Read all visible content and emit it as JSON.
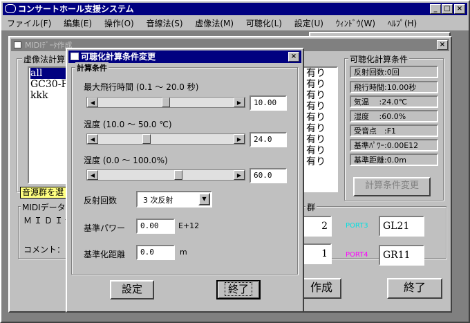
{
  "app": {
    "title": "コンサートホール支援システム",
    "menu": [
      "ファイル(F)",
      "編集(E)",
      "操作(O)",
      "音線法(S)",
      "虚像法(M)",
      "可聴化(L)",
      "設定(U)",
      "ｳｨﾝﾄﾞｳ(W)",
      "ﾍﾙﾌﾟ(H)"
    ]
  },
  "midi_window": {
    "title": "MIDIﾃﾞｰﾀ作成",
    "mirror_group_label": "虚像法計算",
    "mirror_items": [
      "all",
      "GC30-F1",
      "kkk"
    ],
    "ari_items": [
      "有り",
      "有り",
      "有り",
      "有り",
      "有り",
      "有り",
      "有り",
      "有り",
      "有り"
    ],
    "sound_group_label": "音源群を選",
    "midi_data_label": "MIDIデータ",
    "midi_file_label": "ＭＩＤＩﾃ",
    "comment_label": "コメント：",
    "port_group_suffix": "群",
    "port_values": {
      "p1": "2",
      "p3": "1",
      "port3_value": "GL21",
      "port4_value": "GR11"
    },
    "port3_label": "PORT3",
    "port4_label": "PORT4",
    "create_button": "作成",
    "end_button": "終了",
    "calc_cond_title": "可聴化計算条件",
    "calc_info": [
      "反射回数:0回",
      "飛行時間:10.00秒",
      "気温　 :24.0℃",
      "湿度　 :60.0%",
      "受音点　:F1",
      "基準ﾊﾟﾜｰ:0.00E12",
      "基準距離:0.0m"
    ],
    "change_cond_button": "計算条件変更"
  },
  "dialog": {
    "title": "可聴化計算条件変更",
    "group_label": "計算条件",
    "max_time_label": "最大飛行時間 (0.1 〜 20.0 秒)",
    "max_time_value": "10.00",
    "max_time_fraction": 0.5,
    "temp_label": "温度 (10.0 〜 50.0 ℃)",
    "temp_value": "24.0",
    "temp_fraction": 0.35,
    "humid_label": "湿度 (0.0 〜 100.0%)",
    "humid_value": "60.0",
    "humid_fraction": 0.6,
    "reflect_label": "反射回数",
    "reflect_value": "3 次反射",
    "power_label": "基準パワー",
    "power_value": "0.00",
    "power_unit": "E+12",
    "distance_label": "基準化距離",
    "distance_value": "0.0",
    "distance_unit": "m",
    "settings_button": "設定",
    "end_button": "終了"
  },
  "colors": {
    "active_title": "#000080",
    "inactive_title": "#808080",
    "port3_color": "#00e0e0",
    "port4_color": "#ff00ff",
    "sound_group_bg": "#ffff80"
  }
}
